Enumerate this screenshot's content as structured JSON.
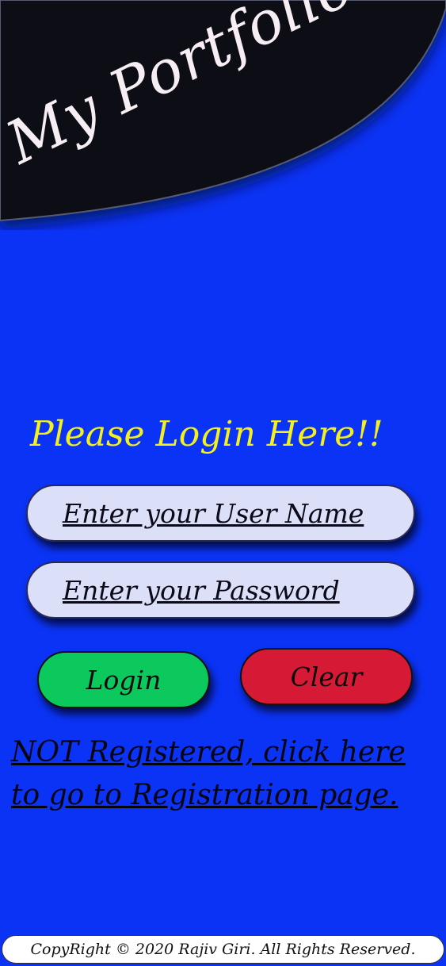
{
  "header": {
    "title": "My Portfolio"
  },
  "login": {
    "heading": "Please Login Here!!",
    "username_placeholder": "Enter your User Name",
    "password_placeholder": "Enter your Password",
    "login_label": "Login",
    "clear_label": "Clear",
    "register_link": "NOT Registered, click here to go to Registration page."
  },
  "footer": {
    "copyright": "CopyRight © 2020 Rajiv Giri. All Rights Reserved."
  },
  "colors": {
    "background": "#0b33f5",
    "header": "#0a0c16",
    "heading": "#f4f01e",
    "input": "#dcdff8",
    "login_button": "#0cc95d",
    "clear_button": "#d61a35"
  }
}
